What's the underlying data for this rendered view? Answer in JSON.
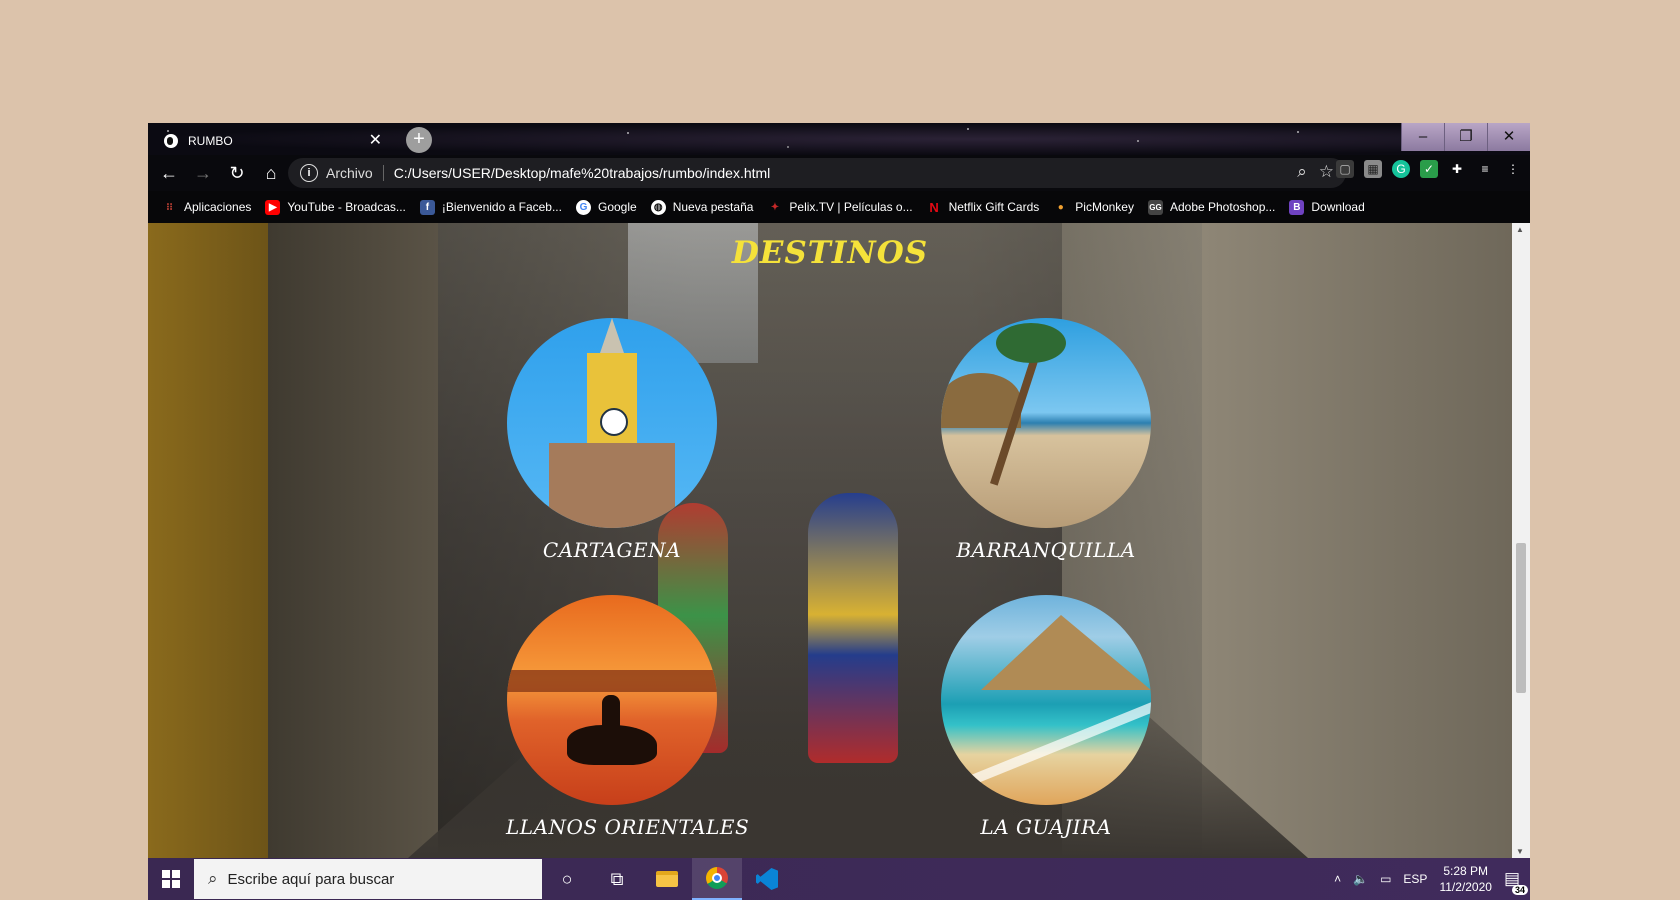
{
  "browser": {
    "tab_title": "RUMBO",
    "new_tab": "+",
    "address_scheme": "Archivo",
    "address_url": "C:/Users/USER/Desktop/mafe%20trabajos/rumbo/index.html"
  },
  "bookmarks": [
    {
      "label": "Aplicaciones",
      "icon": "apps-grid-icon",
      "color": "#e04b3c"
    },
    {
      "label": "YouTube - Broadcas...",
      "icon": "youtube-icon",
      "color": "#ff0000"
    },
    {
      "label": "¡Bienvenido a Faceb...",
      "icon": "facebook-icon",
      "color": "#3b5998"
    },
    {
      "label": "Google",
      "icon": "google-icon",
      "color": "#ffffff"
    },
    {
      "label": "Nueva pestaña",
      "icon": "globe-icon",
      "color": "#ffffff"
    },
    {
      "label": "Pelix.TV | Películas o...",
      "icon": "pelix-icon",
      "color": "#c62828"
    },
    {
      "label": "Netflix Gift Cards",
      "icon": "netflix-icon",
      "color": "#e50914"
    },
    {
      "label": "PicMonkey",
      "icon": "picmonkey-icon",
      "color": "#f0a030"
    },
    {
      "label": "Adobe Photoshop...",
      "icon": "gg-icon",
      "color": "#444444"
    },
    {
      "label": "Download",
      "icon": "bootstrap-icon",
      "color": "#6f42c1"
    }
  ],
  "page": {
    "title": "DESTINOS",
    "destinations": [
      {
        "name": "CARTAGENA"
      },
      {
        "name": "BARRANQUILLA"
      },
      {
        "name": "LLANOS ORIENTALES"
      },
      {
        "name": "LA GUAJIRA"
      }
    ],
    "title_color": "#f5e23a"
  },
  "taskbar": {
    "search_placeholder": "Escribe aquí para buscar",
    "language": "ESP",
    "time": "5:28 PM",
    "date": "11/2/2020",
    "notifications": "34"
  }
}
